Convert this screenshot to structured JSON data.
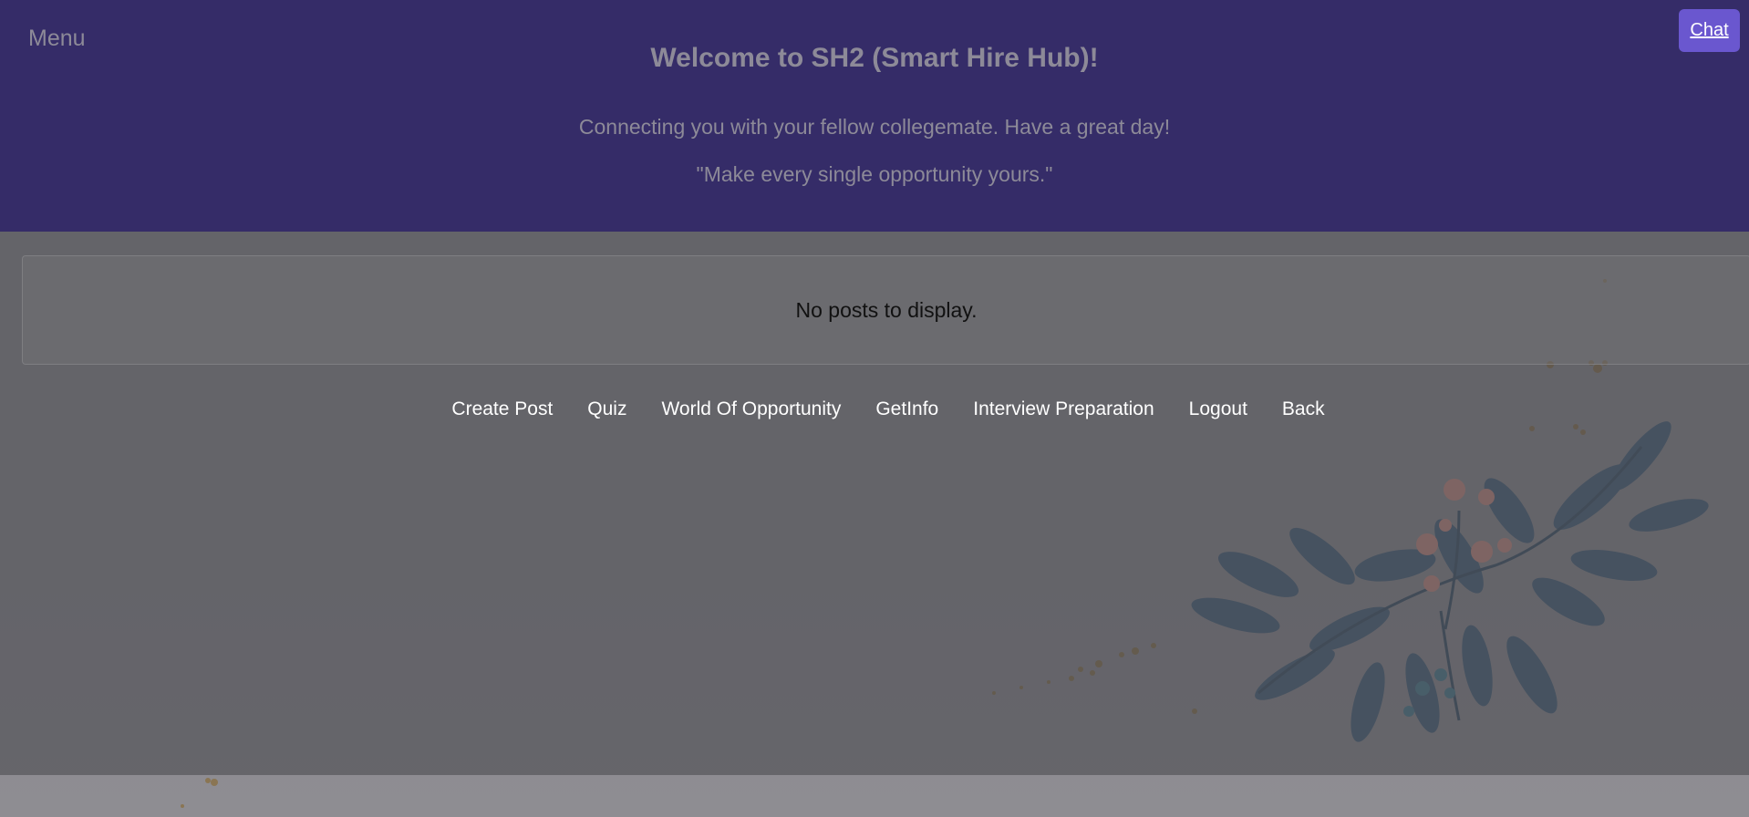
{
  "header": {
    "menu_label": "Menu",
    "title": "Welcome to SH2 (Smart Hire Hub)!",
    "subtitle": "Connecting you with your fellow collegemate. Have a great day!",
    "quote": "\"Make every single opportunity yours.\""
  },
  "chat": {
    "label": "Chat"
  },
  "posts": {
    "empty_message": "No posts to display."
  },
  "nav": {
    "items": [
      {
        "label": "Create Post"
      },
      {
        "label": "Quiz"
      },
      {
        "label": "World Of Opportunity"
      },
      {
        "label": "GetInfo"
      },
      {
        "label": "Interview Preparation"
      },
      {
        "label": "Logout"
      },
      {
        "label": "Back"
      }
    ]
  },
  "colors": {
    "header_bg": "#352c68",
    "chat_bg": "#6a57cf",
    "header_text": "#8d8a98"
  }
}
